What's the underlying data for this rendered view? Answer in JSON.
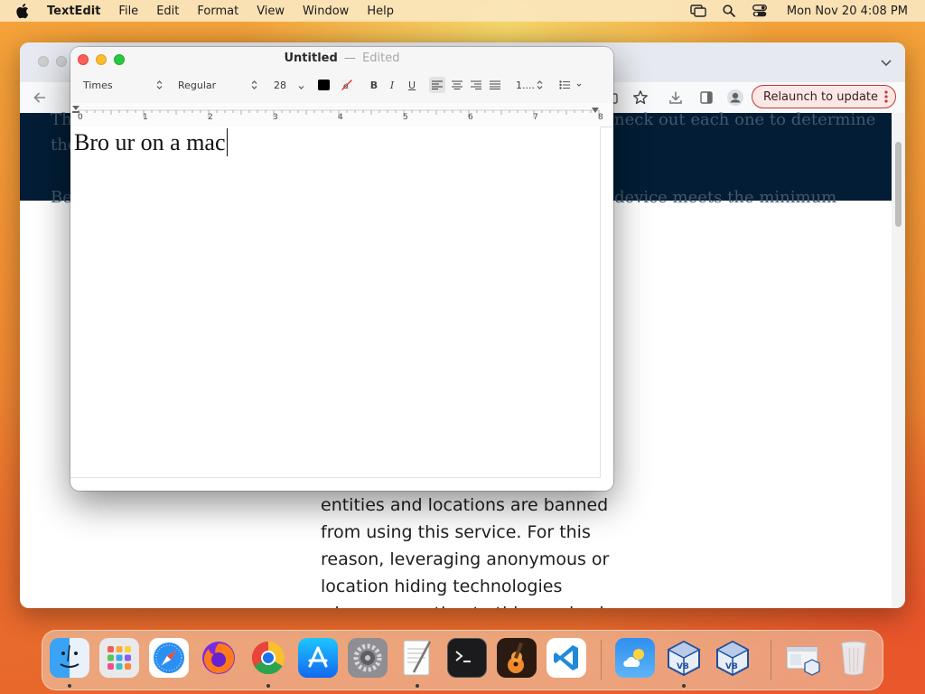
{
  "menubar": {
    "app_name": "TextEdit",
    "items": [
      "File",
      "Edit",
      "Format",
      "View",
      "Window",
      "Help"
    ],
    "clock": "Mon Nov 20  4:08 PM"
  },
  "browser": {
    "relaunch_label": "Relaunch to update",
    "band_text": {
      "line1_left": "Th",
      "line1_right": "neck out each one to determine",
      "line2_left": "the",
      "line3_left": "Be",
      "line3_right": "device meets the minimum"
    },
    "article_lines": [
      "entities and locations are banned",
      "from using this service. For this",
      "reason, leveraging anonymous or",
      "location hiding technologies",
      "when connecting to this service is"
    ]
  },
  "textedit": {
    "title": "Untitled",
    "separator": "—",
    "status": "Edited",
    "font_family": "Times",
    "font_style": "Regular",
    "font_size": "28",
    "bold_label": "B",
    "italic_label": "I",
    "underline_label": "U",
    "spacing_label": "1....",
    "ruler_numbers": [
      "0",
      "1",
      "2",
      "3",
      "4",
      "5",
      "6",
      "7",
      "8"
    ],
    "document_text": "Bro ur on a mac"
  },
  "colors": {
    "close": "#fe5f57",
    "minimize": "#febc2e",
    "zoom": "#28c840",
    "relaunch_border": "#c5362f",
    "dark_band": "#021d35"
  },
  "dock": {
    "apps": [
      "finder-icon",
      "launchpad-icon",
      "safari-icon",
      "firefox-icon",
      "chrome-icon",
      "app-store-icon",
      "system-settings-icon",
      "textedit-icon",
      "terminal-icon",
      "garageband-icon",
      "vscode-icon",
      "weather-icon",
      "virtualbox-icon",
      "virtualbox-vm-icon",
      "downloads-stack-icon",
      "trash-icon"
    ]
  }
}
